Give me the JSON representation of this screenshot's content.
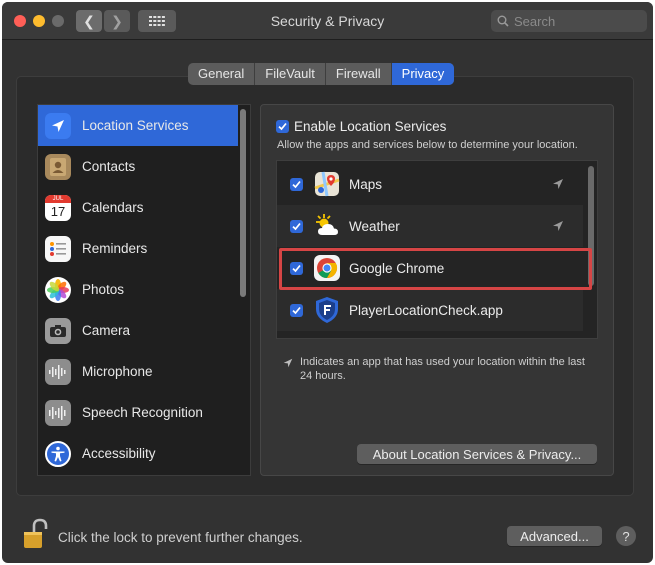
{
  "window": {
    "title": "Security & Privacy",
    "search_placeholder": "Search"
  },
  "tabs": [
    {
      "label": "General"
    },
    {
      "label": "FileVault"
    },
    {
      "label": "Firewall"
    },
    {
      "label": "Privacy",
      "active": true
    }
  ],
  "sidebar": {
    "items": [
      {
        "label": "Location Services",
        "icon": "location-arrow-icon",
        "selected": true
      },
      {
        "label": "Contacts",
        "icon": "contacts-icon"
      },
      {
        "label": "Calendars",
        "icon": "calendar-icon",
        "icon_month": "JUL",
        "icon_day": "17"
      },
      {
        "label": "Reminders",
        "icon": "reminders-icon"
      },
      {
        "label": "Photos",
        "icon": "photos-icon"
      },
      {
        "label": "Camera",
        "icon": "camera-icon"
      },
      {
        "label": "Microphone",
        "icon": "microphone-icon"
      },
      {
        "label": "Speech Recognition",
        "icon": "speech-recognition-icon"
      },
      {
        "label": "Accessibility",
        "icon": "accessibility-icon"
      }
    ]
  },
  "location": {
    "enable_label": "Enable Location Services",
    "enable_checked": true,
    "description": "Allow the apps and services below to determine your location.",
    "apps": [
      {
        "name": "Maps",
        "icon": "maps-icon",
        "checked": true,
        "recent_use": true
      },
      {
        "name": "Weather",
        "icon": "weather-icon",
        "checked": true,
        "recent_use": true
      },
      {
        "name": "Google Chrome",
        "icon": "chrome-icon",
        "checked": true,
        "recent_use": false,
        "highlighted": true
      },
      {
        "name": "PlayerLocationCheck.app",
        "icon": "shield-icon",
        "checked": true,
        "recent_use": false
      }
    ],
    "note": "Indicates an app that has used your location within the last 24 hours.",
    "about_button": "About Location Services & Privacy..."
  },
  "footer": {
    "lock_text": "Click the lock to prevent further changes.",
    "advanced_button": "Advanced...",
    "help_button": "?"
  },
  "colors": {
    "accent": "#2f68d8",
    "highlight_border": "#d64545"
  }
}
